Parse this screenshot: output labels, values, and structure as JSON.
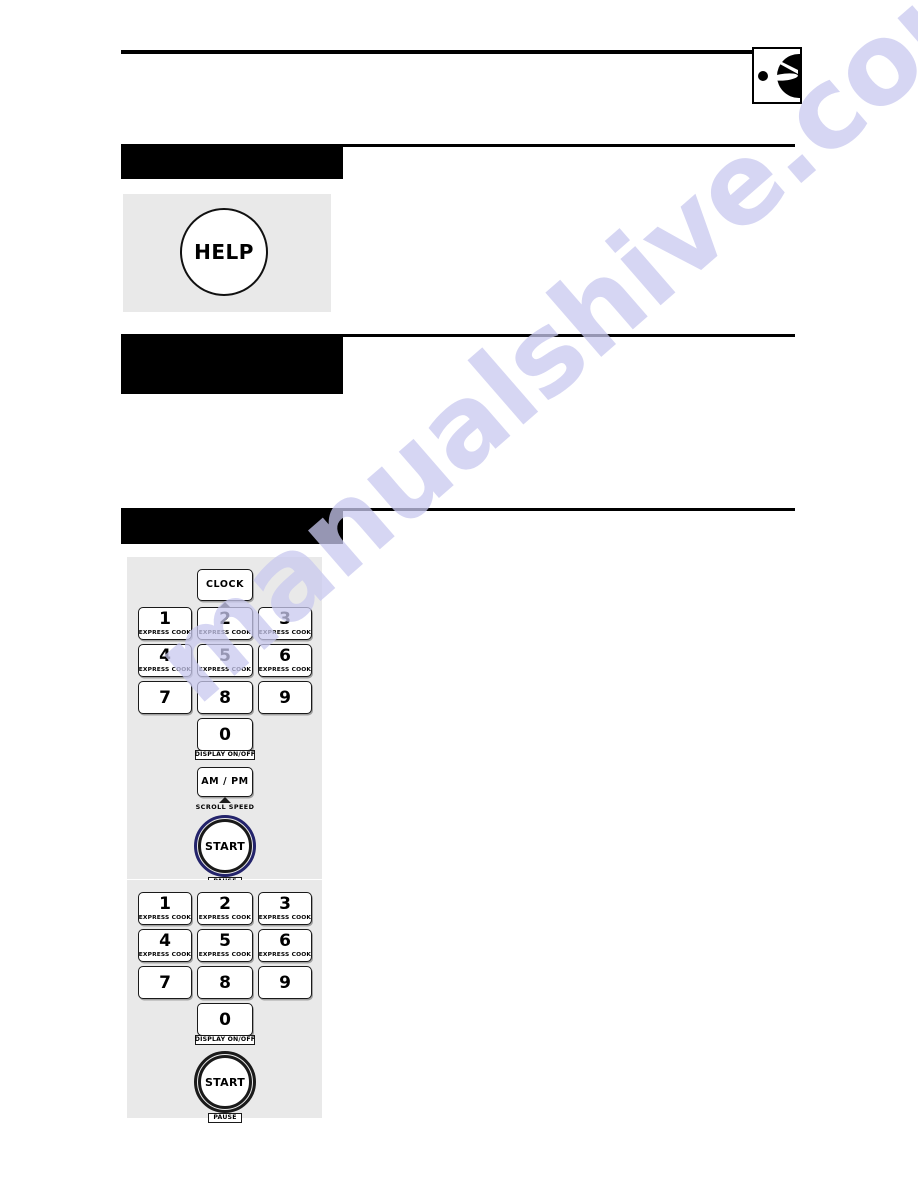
{
  "page": {
    "background": "#ffffff",
    "watermark_text": "manualshive.com",
    "watermark_color": "#c9c9ef"
  },
  "corner_icon": {
    "name": "control-knob-icon",
    "description": "dial knob with pointer in box"
  },
  "sections": [
    {
      "id": "help",
      "header_label": "",
      "body_text": "",
      "panel": {
        "button": {
          "label": "HELP",
          "shape": "circle"
        }
      }
    },
    {
      "id": "sound",
      "header_label": "",
      "body_text": ""
    },
    {
      "id": "clock",
      "header_label": "",
      "body_text": "",
      "body_text_b": ""
    }
  ],
  "keypad_1": {
    "clock_key": {
      "label": "CLOCK",
      "has_marker": true
    },
    "keys": [
      {
        "digit": "1",
        "sub": "EXPRESS COOK"
      },
      {
        "digit": "2",
        "sub": "EXPRESS COOK"
      },
      {
        "digit": "3",
        "sub": "EXPRESS COOK"
      },
      {
        "digit": "4",
        "sub": "EXPRESS COOK"
      },
      {
        "digit": "5",
        "sub": "EXPRESS COOK"
      },
      {
        "digit": "6",
        "sub": "EXPRESS COOK"
      },
      {
        "digit": "7",
        "sub": ""
      },
      {
        "digit": "8",
        "sub": ""
      },
      {
        "digit": "9",
        "sub": ""
      }
    ],
    "zero_key": {
      "digit": "0",
      "caption": "DISPLAY ON/OFF"
    },
    "ampm_key": {
      "label": "AM / PM",
      "caption": "SCROLL SPEED",
      "has_marker": true
    },
    "start_key": {
      "label": "START",
      "caption": "PAUSE",
      "ring_color": "#23236b"
    }
  },
  "keypad_2": {
    "keys": [
      {
        "digit": "1",
        "sub": "EXPRESS COOK"
      },
      {
        "digit": "2",
        "sub": "EXPRESS COOK"
      },
      {
        "digit": "3",
        "sub": "EXPRESS COOK"
      },
      {
        "digit": "4",
        "sub": "EXPRESS COOK"
      },
      {
        "digit": "5",
        "sub": "EXPRESS COOK"
      },
      {
        "digit": "6",
        "sub": "EXPRESS COOK"
      },
      {
        "digit": "7",
        "sub": ""
      },
      {
        "digit": "8",
        "sub": ""
      },
      {
        "digit": "9",
        "sub": ""
      }
    ],
    "zero_key": {
      "digit": "0",
      "caption": "DISPLAY ON/OFF"
    },
    "start_key": {
      "label": "START",
      "caption": "PAUSE",
      "ring_color": "#1a1a1a"
    }
  }
}
